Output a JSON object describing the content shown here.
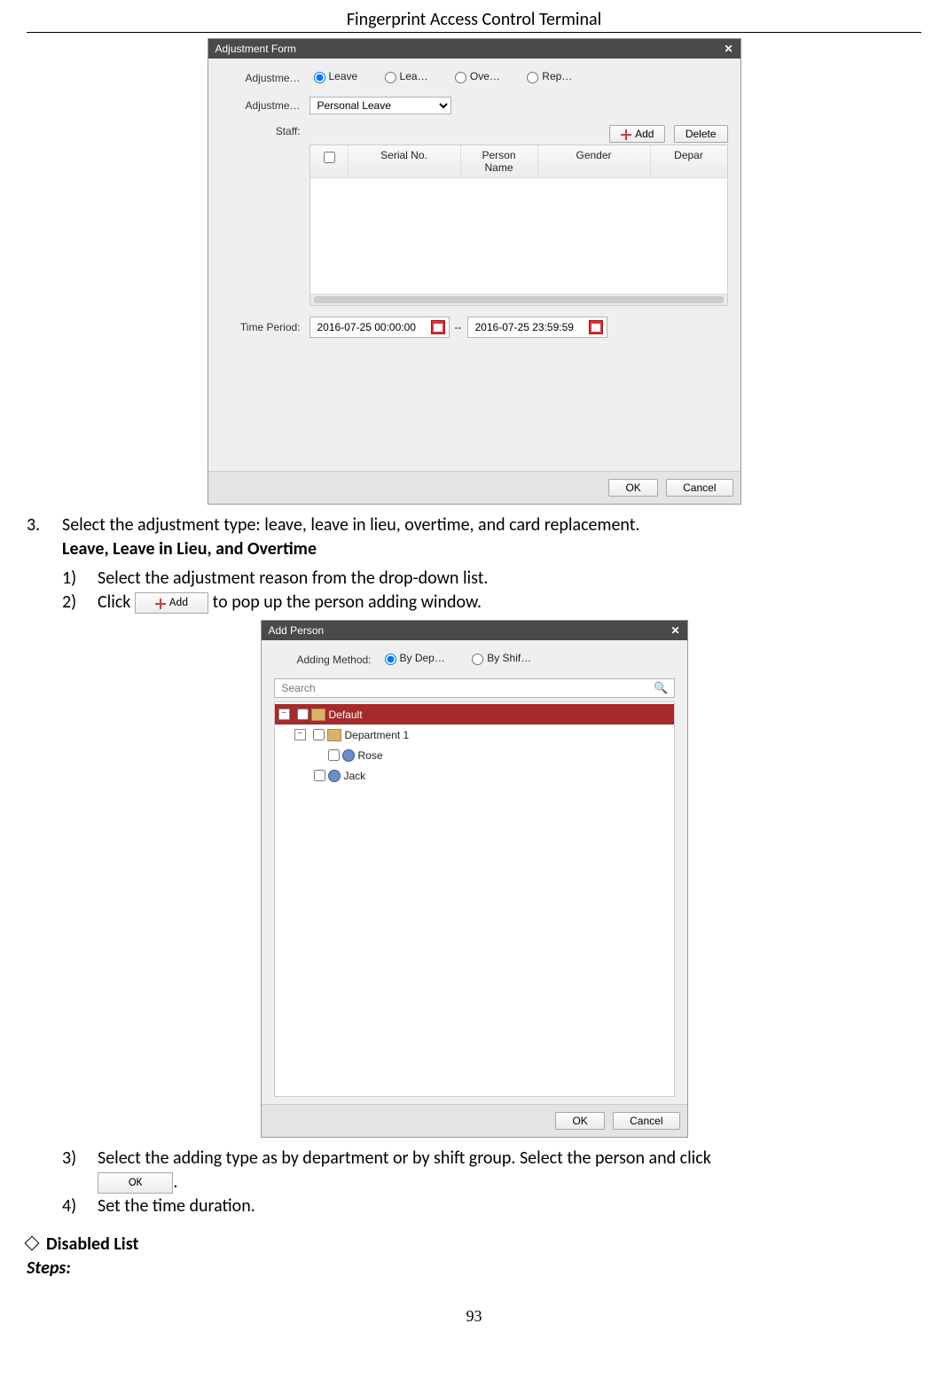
{
  "header": {
    "title": "Fingerprint Access Control Terminal"
  },
  "adjustment_form": {
    "title": "Adjustment Form",
    "label_type": "Adjustme…",
    "radios": {
      "leave": "Leave",
      "lea": "Lea…",
      "ove": "Ove…",
      "rep": "Rep…"
    },
    "label_reason": "Adjustme…",
    "reason_value": "Personal Leave",
    "label_staff": "Staff:",
    "add_btn": "Add",
    "del_btn": "Delete",
    "columns": {
      "serial": "Serial No.",
      "name": "Person Name",
      "gender": "Gender",
      "depart": "Depar"
    },
    "label_time": "Time Period:",
    "time_from": "2016-07-25 00:00:00",
    "time_sep": "--",
    "time_to": "2016-07-25 23:59:59",
    "ok": "OK",
    "cancel": "Cancel"
  },
  "add_person": {
    "title": "Add Person",
    "label_method": "Adding Method:",
    "radio_dep": "By Dep…",
    "radio_shift": "By Shif…",
    "search_placeholder": "Search",
    "tree": {
      "root": "Default",
      "dept": "Department 1",
      "p1": "Rose",
      "p2": "Jack"
    },
    "ok": "OK",
    "cancel": "Cancel"
  },
  "doc": {
    "step3_marker": "3.",
    "step3": "Select the adjustment type: leave, leave in lieu, overtime, and card replacement.",
    "step3_sub": "Leave, Leave in Lieu, and Overtime",
    "s1_marker": "1)",
    "s1": "Select the adjustment reason from the drop-down list.",
    "s2_marker": "2)",
    "s2a": "Click ",
    "s2_btn": "Add",
    "s2b": " to pop up the person adding window.",
    "s3_marker": "3)",
    "s3": "Select  the  adding  type  as  by  department  or  by  shift  group.  Select  the  person  and  click",
    "s3_btn": "OK",
    "s4_marker": "4)",
    "s4": "Set the time duration.",
    "disabled_list": "Disabled List",
    "steps": "Steps:",
    "page_number": "93"
  }
}
